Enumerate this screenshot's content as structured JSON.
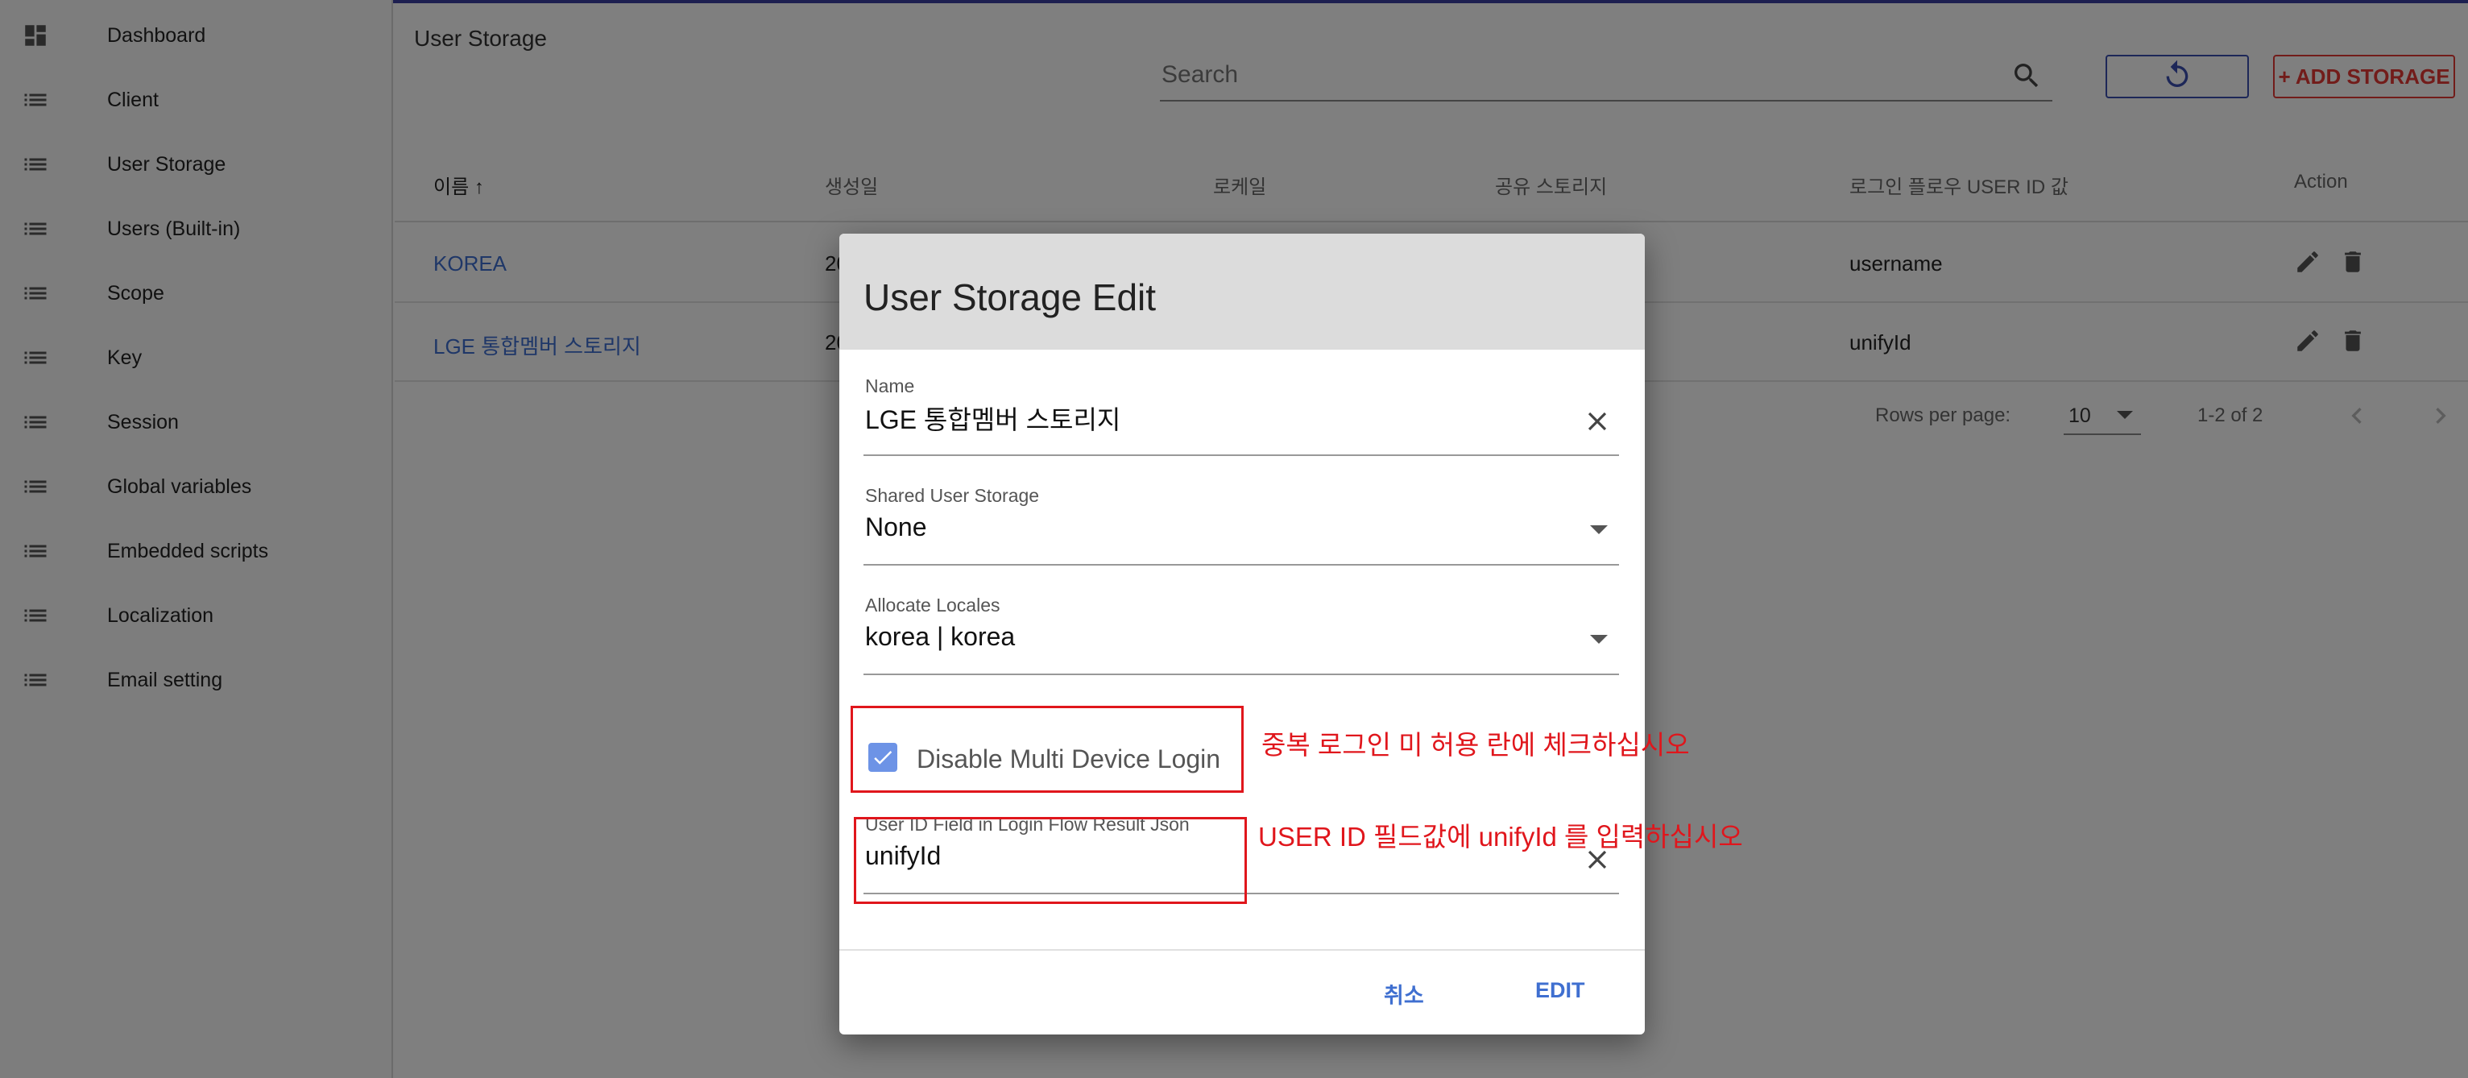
{
  "sidebar": {
    "items": [
      {
        "label": "Dashboard",
        "icon": "dashboard-icon"
      },
      {
        "label": "Client",
        "icon": "list-icon"
      },
      {
        "label": "User Storage",
        "icon": "list-icon"
      },
      {
        "label": "Users (Built-in)",
        "icon": "list-icon"
      },
      {
        "label": "Scope",
        "icon": "list-icon"
      },
      {
        "label": "Key",
        "icon": "list-icon"
      },
      {
        "label": "Session",
        "icon": "list-icon"
      },
      {
        "label": "Global variables",
        "icon": "list-icon"
      },
      {
        "label": "Embedded scripts",
        "icon": "list-icon"
      },
      {
        "label": "Localization",
        "icon": "list-icon"
      },
      {
        "label": "Email setting",
        "icon": "list-icon"
      }
    ]
  },
  "header": {
    "title": "User Storage",
    "search_placeholder": "Search",
    "add_button": "+ ADD STORAGE"
  },
  "table": {
    "columns": [
      "이름 ↑",
      "생성일",
      "로케일",
      "공유 스토리지",
      "로그인 플로우 USER ID 값",
      "Action"
    ],
    "rows": [
      {
        "name": "KOREA",
        "created": "20",
        "user_id_field": "username"
      },
      {
        "name": "LGE 통합멤버 스토리지",
        "created": "20",
        "user_id_field": "unifyId"
      }
    ],
    "rows_per_page_label": "Rows per page:",
    "rows_per_page": "10",
    "range": "1-2 of 2"
  },
  "dialog": {
    "title": "User Storage Edit",
    "name": {
      "label": "Name",
      "value": "LGE 통합멤버 스토리지"
    },
    "shared": {
      "label": "Shared User Storage",
      "value": "None"
    },
    "locales": {
      "label": "Allocate Locales",
      "value": "korea | korea"
    },
    "multi_device": {
      "label": "Disable Multi Device Login",
      "checked": true
    },
    "user_id_field": {
      "label": "User ID Field in Login Flow Result Json",
      "value": "unifyId"
    },
    "cancel": "취소",
    "confirm": "EDIT"
  },
  "annotations": {
    "checkbox_note": "중복 로그인 미 허용 란에 체크하십시오",
    "field_note": "USER ID 필드값에 unifyId 를 입력하십시오"
  },
  "colors": {
    "accent": "#3f6fd0",
    "danger": "#e53935",
    "annotation": "#e0161c",
    "checkbox": "#6d93e6"
  }
}
